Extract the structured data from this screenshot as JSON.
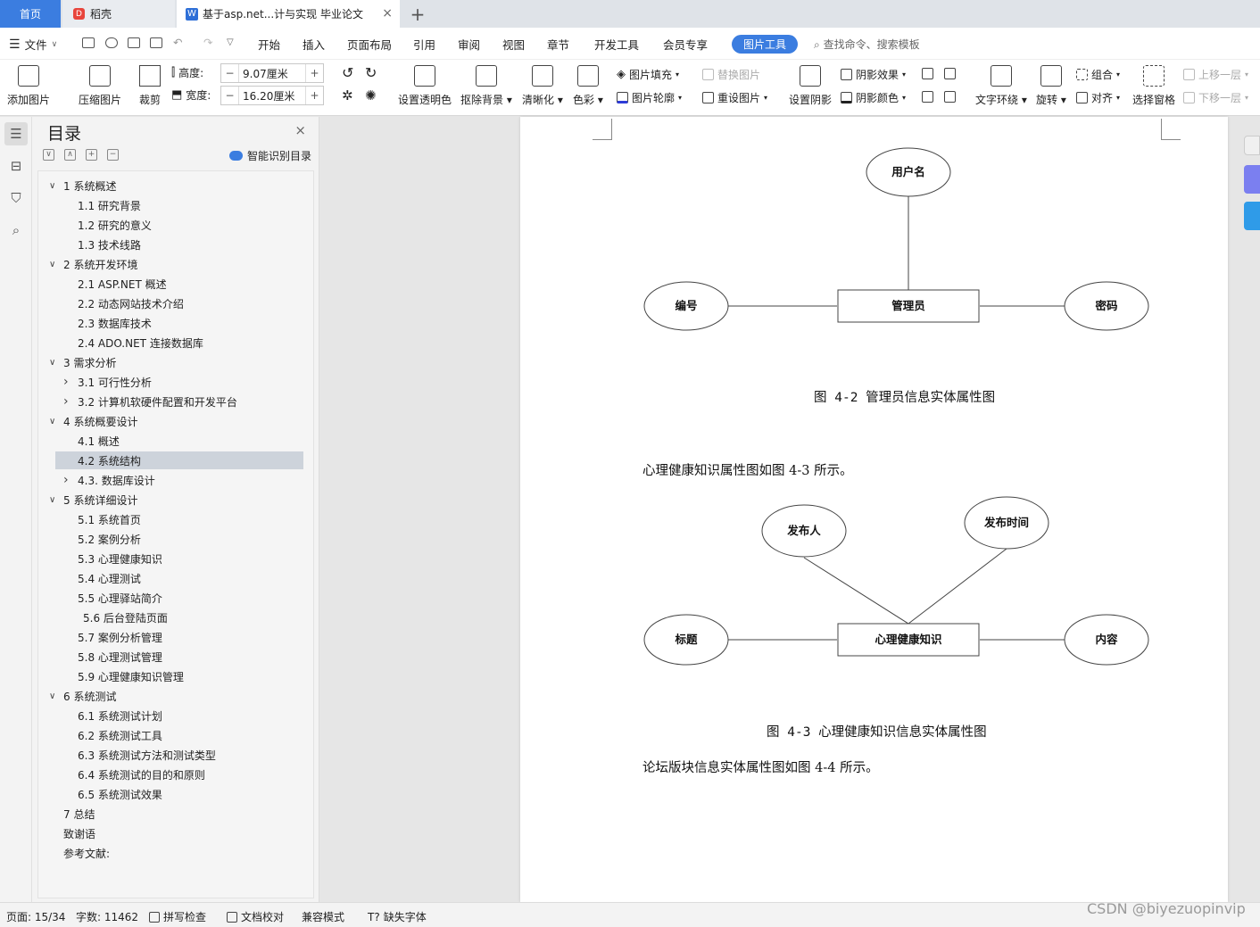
{
  "tabs": {
    "home": "首页",
    "draft": "稻壳",
    "doc": "基于asp.net...计与实现 毕业论文",
    "close": "×",
    "add": "+"
  },
  "menu": {
    "file": "文件",
    "items": [
      "开始",
      "插入",
      "页面布局",
      "引用",
      "审阅",
      "视图",
      "章节",
      "开发工具",
      "会员专享"
    ],
    "active": "图片工具",
    "search": "查找命令、搜索模板"
  },
  "toolbar": {
    "add_picture": "添加图片",
    "compress": "压缩图片",
    "crop": "裁剪",
    "height_label": "高度:",
    "height_value": "9.07厘米",
    "width_label": "宽度:",
    "width_value": "16.20厘米",
    "minus": "−",
    "plus": "+",
    "set_transparent": "设置透明色",
    "remove_bg": "抠除背景",
    "sharpen": "清晰化",
    "color": "色彩",
    "pic_fill": "图片填充",
    "pic_outline": "图片轮廓",
    "replace_pic": "替换图片",
    "reset_pic": "重设图片",
    "set_shadow": "设置阴影",
    "shadow_effect": "阴影效果",
    "shadow_color": "阴影颜色",
    "text_wrap": "文字环绕",
    "rotate": "旋转",
    "group": "组合",
    "align": "对齐",
    "select_pane": "选择窗格",
    "bring_forward": "上移一层",
    "send_backward": "下移一层"
  },
  "toc": {
    "title": "目录",
    "close": "×",
    "smart": "智能识别目录",
    "items": [
      {
        "text": "1  系统概述",
        "level": 0,
        "arrow": "expanded"
      },
      {
        "text": "1.1  研究背景",
        "level": 1
      },
      {
        "text": "1.2 研究的意义",
        "level": 1
      },
      {
        "text": "1.3 技术线路",
        "level": 1
      },
      {
        "text": "2  系统开发环境",
        "level": 0,
        "arrow": "expanded"
      },
      {
        "text": "2.1 ASP.NET 概述",
        "level": 1
      },
      {
        "text": "2.2 动态网站技术介绍",
        "level": 1
      },
      {
        "text": "2.3  数据库技术",
        "level": 1
      },
      {
        "text": "2.4    ADO.NET 连接数据库",
        "level": 1
      },
      {
        "text": "3  需求分析",
        "level": 0,
        "arrow": "expanded"
      },
      {
        "text": "3.1 可行性分析",
        "level": 1,
        "arrow": "collapsed"
      },
      {
        "text": "3.2 计算机软硬件配置和开发平台",
        "level": 1,
        "arrow": "collapsed"
      },
      {
        "text": "4 系统概要设计",
        "level": 0,
        "arrow": "expanded"
      },
      {
        "text": "4.1  概述",
        "level": 1
      },
      {
        "text": "4.2  系统结构",
        "level": 1,
        "selected": true
      },
      {
        "text": "4.3.  数据库设计",
        "level": 1,
        "arrow": "collapsed"
      },
      {
        "text": "5 系统详细设计",
        "level": 0,
        "arrow": "expanded"
      },
      {
        "text": "5.1  系统首页",
        "level": 1
      },
      {
        "text": "5.2 案例分析",
        "level": 1
      },
      {
        "text": "5.3 心理健康知识",
        "level": 1
      },
      {
        "text": "5.4 心理测试",
        "level": 1
      },
      {
        "text": "5.5 心理驿站简介",
        "level": 1
      },
      {
        "text": "5.6 后台登陆页面",
        "level": 2
      },
      {
        "text": "5.7 案例分析管理",
        "level": 1
      },
      {
        "text": "5.8 心理测试管理",
        "level": 1
      },
      {
        "text": "5.9 心理健康知识管理",
        "level": 1
      },
      {
        "text": "6 系统测试",
        "level": 0,
        "arrow": "expanded"
      },
      {
        "text": "6.1 系统测试计划",
        "level": 1
      },
      {
        "text": "6.2  系统测试工具",
        "level": 1
      },
      {
        "text": "6.3 系统测试方法和测试类型",
        "level": 1
      },
      {
        "text": "6.4 系统测试的目的和原则",
        "level": 1
      },
      {
        "text": "6.5 系统测试效果",
        "level": 1
      },
      {
        "text": "7 总结",
        "level": 0
      },
      {
        "text": "致谢语",
        "level": 0
      },
      {
        "text": "参考文献:",
        "level": 0
      }
    ]
  },
  "document": {
    "diagram1": {
      "top": "用户名",
      "left": "编号",
      "center": "管理员",
      "right": "密码"
    },
    "caption1": "图 4-2 管理员信息实体属性图",
    "para1": "心理健康知识属性图如图 4-3 所示。",
    "diagram2": {
      "top_left": "发布人",
      "top_right": "发布时间",
      "left": "标题",
      "center": "心理健康知识",
      "right": "内容"
    },
    "caption2": "图 4-3 心理健康知识信息实体属性图",
    "para2": "论坛版块信息实体属性图如图 4-4 所示。"
  },
  "status": {
    "page": "页面: 15/34",
    "words": "字数: 11462",
    "spell": "拼写检查",
    "proof": "文档校对",
    "compat": "兼容模式",
    "missing_font": "缺失字体"
  },
  "watermark": "CSDN @biyezuopinvip",
  "colors": {
    "accent": "#3b7de0",
    "toc_selected": "#cdd3db"
  }
}
